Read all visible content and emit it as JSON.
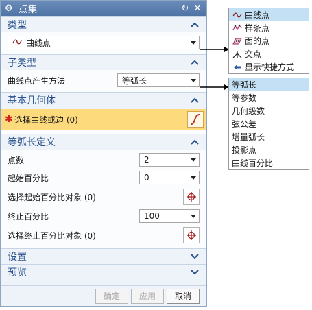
{
  "dialog": {
    "title": "点集",
    "icons": [
      "gear-icon",
      "reset-icon",
      "close-icon"
    ]
  },
  "type_section": {
    "header": "类型",
    "selected": "曲线点",
    "options": [
      "曲线点",
      "样条点",
      "面的点",
      "交点",
      "显示快捷方式"
    ]
  },
  "subtype_section": {
    "header": "子类型",
    "label": "曲线点产生方法",
    "selected": "等弧长",
    "options": [
      "等弧长",
      "等参数",
      "几何级数",
      "弦公差",
      "增量弧长",
      "投影点",
      "曲线百分比"
    ]
  },
  "geometry_section": {
    "header": "基本几何体",
    "select_label": "选择曲线或边 (0)"
  },
  "arc_section": {
    "header": "等弧长定义",
    "point_count_label": "点数",
    "point_count_value": "2",
    "start_pct_label": "起始百分比",
    "start_pct_value": "0",
    "select_start_label": "选择起始百分比对象 (0)",
    "end_pct_label": "终止百分比",
    "end_pct_value": "100",
    "select_end_label": "选择终止百分比对象 (0)"
  },
  "settings_section": {
    "header": "设置"
  },
  "preview_section": {
    "header": "预览"
  },
  "buttons": {
    "ok": "确定",
    "apply": "应用",
    "cancel": "取消"
  },
  "colors": {
    "title_bar": "#5a7fb0",
    "section_header_text": "#28508d",
    "selection_bar": "#fddb7d",
    "highlight": "#c3e0f4",
    "required_star": "#d02020"
  }
}
